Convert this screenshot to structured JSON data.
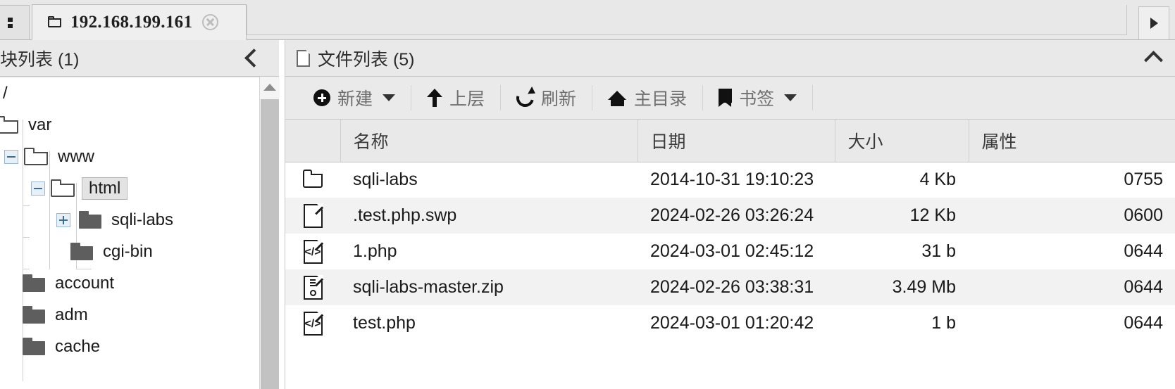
{
  "tabbar": {
    "active_tab": {
      "title": "192.168.199.161",
      "folder_icon": "folder-icon",
      "close_icon": "close-icon"
    },
    "scroll_right_icon": "chevron-right-icon",
    "overflow_icon": "tab-handle-icon"
  },
  "left_panel": {
    "title": "块列表 (1)",
    "collapse_icon": "chevron-left-icon",
    "scrollbar": {
      "up_arrow_icon": "scroll-up-arrow-icon"
    },
    "tree": [
      {
        "label": "/",
        "depth": 0,
        "icon": "none",
        "expander": "none",
        "selected": false
      },
      {
        "label": "var",
        "depth": 0,
        "icon": "folder-open",
        "expander": "none",
        "selected": false
      },
      {
        "label": "www",
        "depth": 1,
        "icon": "folder-open",
        "expander": "minus",
        "selected": false
      },
      {
        "label": "html",
        "depth": 2,
        "icon": "folder-open",
        "expander": "minus",
        "selected": true
      },
      {
        "label": "sqli-labs",
        "depth": 3,
        "icon": "folder-closed",
        "expander": "plus",
        "selected": false
      },
      {
        "label": "cgi-bin",
        "depth": 3,
        "icon": "folder-closed",
        "expander": "none",
        "selected": false
      },
      {
        "label": "account",
        "depth": 1,
        "icon": "folder-closed",
        "expander": "none",
        "selected": false
      },
      {
        "label": "adm",
        "depth": 1,
        "icon": "folder-closed",
        "expander": "none",
        "selected": false
      },
      {
        "label": "cache",
        "depth": 1,
        "icon": "folder-closed",
        "expander": "none",
        "selected": false
      }
    ]
  },
  "right_panel": {
    "title": "文件列表 (5)",
    "title_icon": "document-icon",
    "collapse_icon": "chevron-up-icon",
    "toolbar": [
      {
        "label": "新建",
        "icon": "circle-plus-icon",
        "caret": true
      },
      {
        "label": "上层",
        "icon": "arrow-up-icon",
        "caret": false
      },
      {
        "label": "刷新",
        "icon": "refresh-icon",
        "caret": false
      },
      {
        "label": "主目录",
        "icon": "home-icon",
        "caret": false
      },
      {
        "label": "书签",
        "icon": "bookmark-icon",
        "caret": true
      }
    ],
    "table": {
      "columns": [
        "",
        "名称",
        "日期",
        "大小",
        "属性"
      ],
      "rows": [
        {
          "icon": "folder-icon",
          "name": "sqli-labs",
          "date": "2014-10-31 19:10:23",
          "size": "4 Kb",
          "attr": "0755"
        },
        {
          "icon": "document-icon",
          "name": ".test.php.swp",
          "date": "2024-02-26 03:26:24",
          "size": "12 Kb",
          "attr": "0600"
        },
        {
          "icon": "code-file-icon",
          "name": "1.php",
          "date": "2024-03-01 02:45:12",
          "size": "31 b",
          "attr": "0644"
        },
        {
          "icon": "zip-file-icon",
          "name": "sqli-labs-master.zip",
          "date": "2024-02-26 03:38:31",
          "size": "3.49 Mb",
          "attr": "0644"
        },
        {
          "icon": "code-file-icon",
          "name": "test.php",
          "date": "2024-03-01 01:20:42",
          "size": "1 b",
          "attr": "0644"
        }
      ]
    }
  },
  "colors": {
    "chrome": "#e9e9e9",
    "tab_active": "#efefef",
    "border": "#c9c9c9",
    "row_stripe": "#f2f2f2",
    "text": "#1a1a1a",
    "muted_text": "#6f6f6f",
    "folder_closed": "#5e5e5e",
    "scroll_thumb": "#c2c2c2"
  }
}
